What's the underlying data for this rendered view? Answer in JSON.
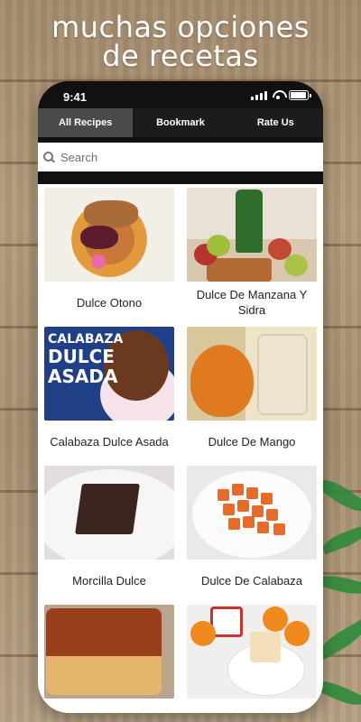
{
  "headline": {
    "line1": "muchas opciones",
    "line2": "de recetas"
  },
  "status_bar": {
    "time": "9:41"
  },
  "tabs": [
    {
      "label": "All Recipes",
      "active": true
    },
    {
      "label": "Bookmark",
      "active": false
    },
    {
      "label": "Rate Us",
      "active": false
    }
  ],
  "search": {
    "placeholder": "Search"
  },
  "recipes": [
    {
      "title": "Dulce Otono"
    },
    {
      "title": "Dulce De Manzana Y Sidra"
    },
    {
      "title": "Calabaza Dulce Asada"
    },
    {
      "title": "Dulce De Mango"
    },
    {
      "title": "Morcilla Dulce"
    },
    {
      "title": "Dulce De Calabaza"
    },
    {
      "title": ""
    },
    {
      "title": ""
    }
  ],
  "thumb_text": {
    "calabaza": "CALABAZA",
    "dulce": "DULCE",
    "asada": "ASADA"
  },
  "colors": {
    "tab_bar": "#1c1c1c",
    "tab_active": "#4a4a4a",
    "headline": "#ffffff"
  }
}
